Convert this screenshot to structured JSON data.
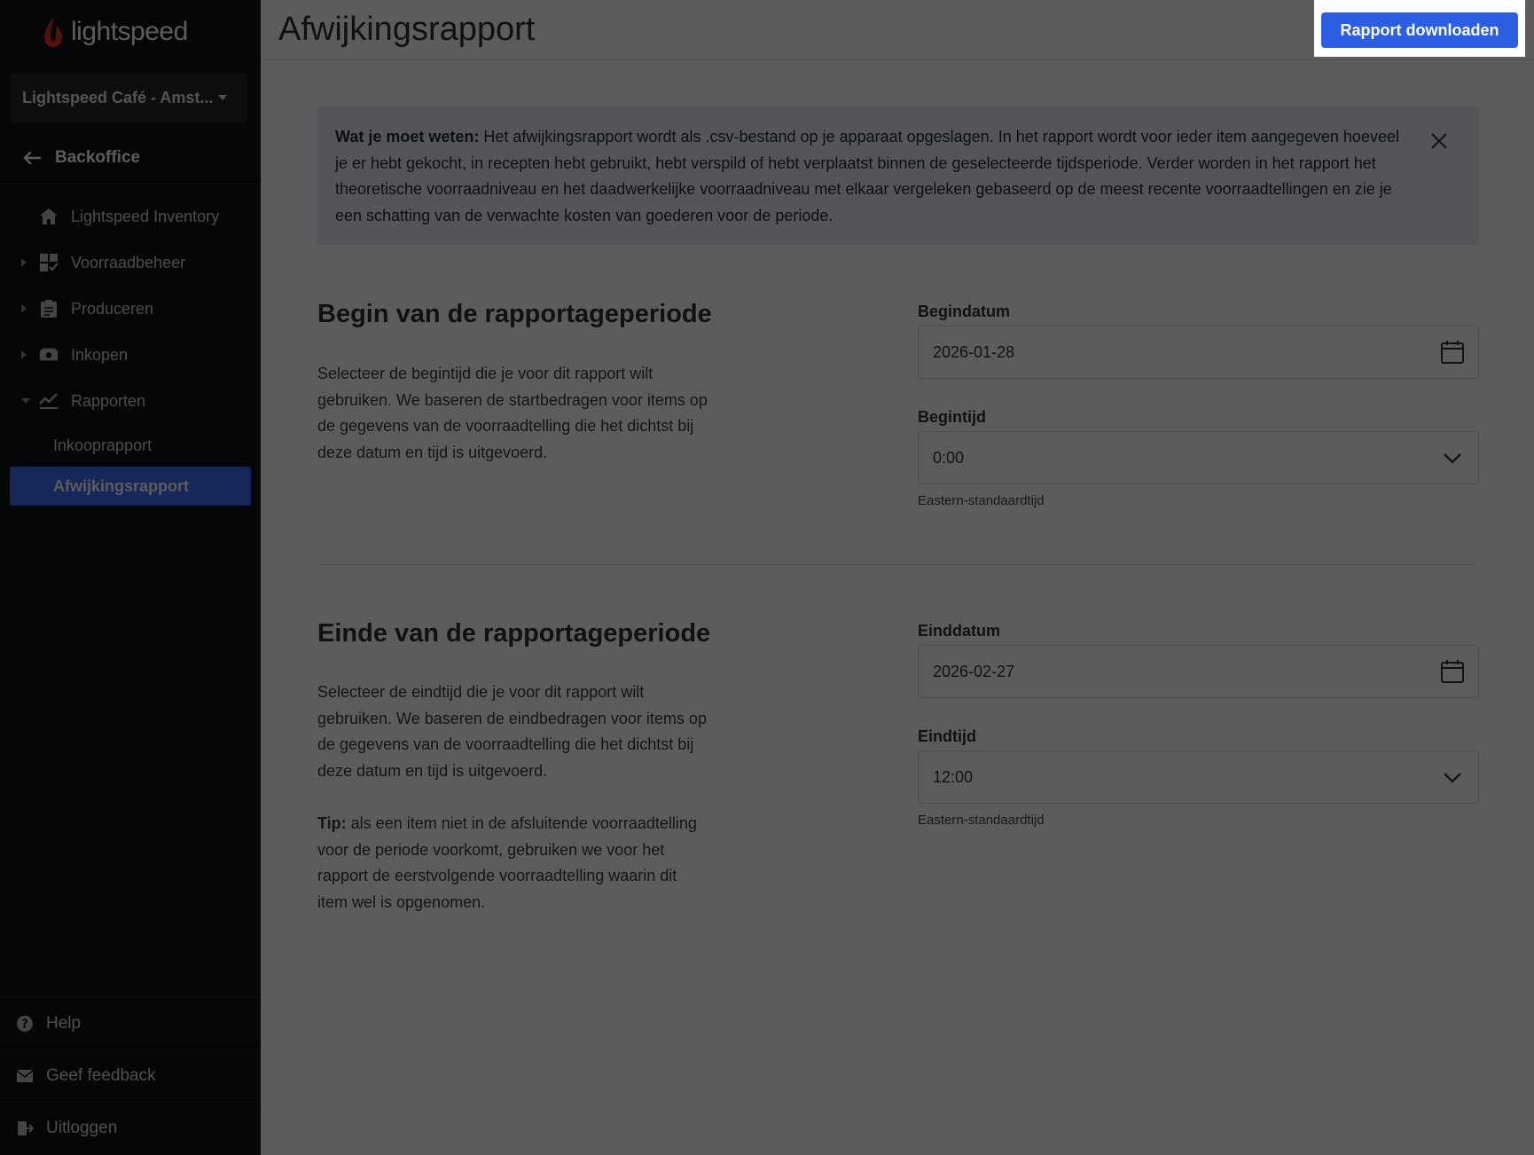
{
  "brand": {
    "name": "lightspeed"
  },
  "sidebar": {
    "store": "Lightspeed Café - Amst...",
    "back": "Backoffice",
    "items": [
      {
        "label": "Lightspeed Inventory",
        "icon": "home-icon"
      },
      {
        "label": "Voorraadbeheer",
        "icon": "inventory-icon"
      },
      {
        "label": "Produceren",
        "icon": "clipboard-icon"
      },
      {
        "label": "Inkopen",
        "icon": "truck-icon"
      },
      {
        "label": "Rapporten",
        "icon": "chart-icon"
      }
    ],
    "sub_items": [
      {
        "label": "Inkooprapport"
      },
      {
        "label": "Afwijkingsrapport"
      }
    ],
    "footer": {
      "help": "Help",
      "feedback": "Geef feedback",
      "logout": "Uitloggen"
    }
  },
  "header": {
    "title": "Afwijkingsrapport",
    "download_label": "Rapport downloaden"
  },
  "info": {
    "lead": "Wat je moet weten:",
    "text": " Het afwijkingsrapport wordt als .csv-bestand op je apparaat opgeslagen. In het rapport wordt voor ieder item aangegeven hoeveel je er hebt gekocht, in recepten hebt gebruikt, hebt verspild of hebt verplaatst binnen de geselecteerde tijdsperiode. Verder worden in het rapport het theoretische voorraadniveau en het daadwerkelijke voorraadniveau met elkaar vergeleken gebaseerd op de meest recente voorraadtellingen en zie je een schatting van de verwachte kosten van goederen voor de periode."
  },
  "start": {
    "title": "Begin van de rapportageperiode",
    "text": "Selecteer de begintijd die je voor dit rapport wilt gebruiken. We baseren de startbedragen voor items op de gegevens van de voorraadtelling die het dichtst bij deze datum en tijd is uitgevoerd.",
    "date_label": "Begindatum",
    "date_value": "2026-01-28",
    "time_label": "Begintijd",
    "time_value": "0:00",
    "timezone": "Eastern-standaardtijd"
  },
  "end": {
    "title": "Einde van de rapportageperiode",
    "text": "Selecteer de eindtijd die je voor dit rapport wilt gebruiken. We baseren de eindbedragen voor items op de gegevens van de voorraadtelling die het dichtst bij deze datum en tijd is uitgevoerd.",
    "tip_lead": "Tip:",
    "tip_text": " als een item niet in de afsluitende voorraadtelling voor de periode voorkomt, gebruiken we voor het rapport de eerstvolgende voorraadtelling waarin dit item wel is opgenomen.",
    "date_label": "Einddatum",
    "date_value": "2026-02-27",
    "time_label": "Eindtijd",
    "time_value": "12:00",
    "timezone": "Eastern-standaardtijd"
  },
  "colors": {
    "accent": "#2b5fe3",
    "sidebar_bg": "#0f1114",
    "active_item": "#3a6ff7",
    "info_bg": "#e5ebf7"
  }
}
